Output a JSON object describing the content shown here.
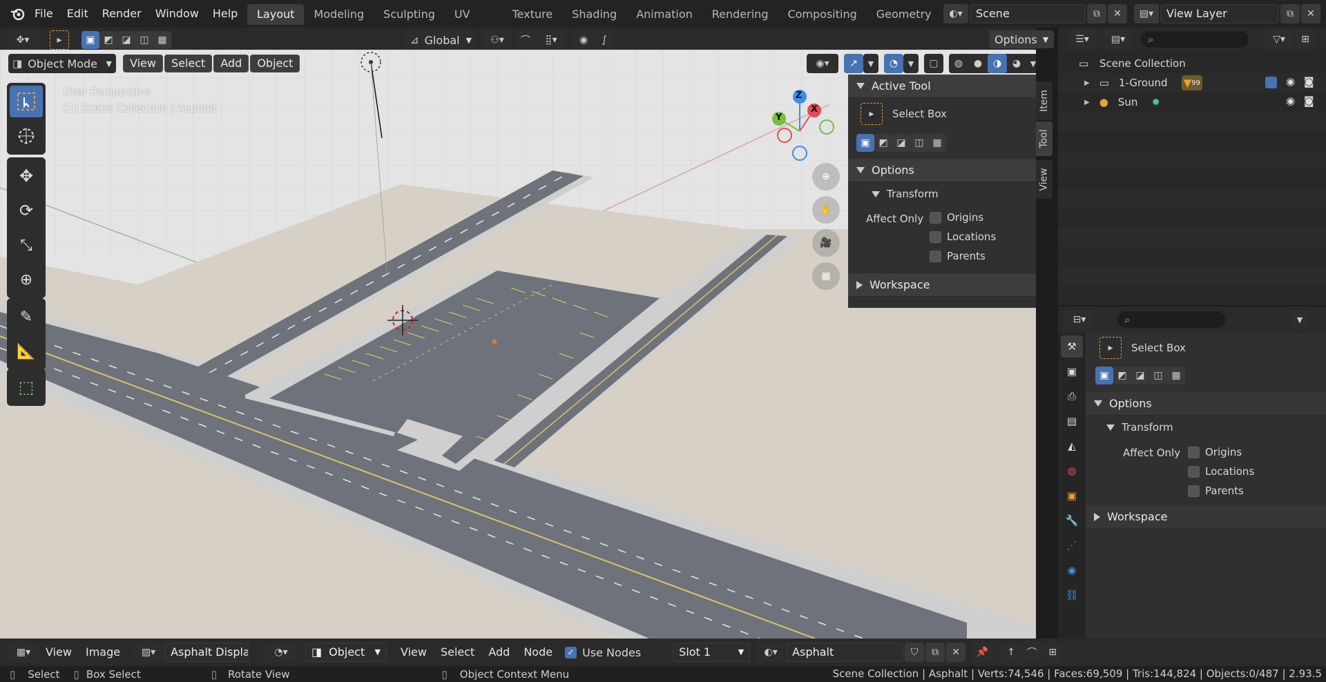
{
  "topbar": {
    "menus": [
      "File",
      "Edit",
      "Render",
      "Window",
      "Help"
    ],
    "workspaces": [
      "Layout",
      "Modeling",
      "Sculpting",
      "UV Editing",
      "Texture Paint",
      "Shading",
      "Animation",
      "Rendering",
      "Compositing",
      "Geometry Nod"
    ],
    "active_workspace": "Layout",
    "scene": "Scene",
    "view_layer": "View Layer"
  },
  "tool_header": {
    "orientation": "Global",
    "options": "Options"
  },
  "viewport_header": {
    "mode": "Object Mode",
    "menus": [
      "View",
      "Select",
      "Add",
      "Object"
    ]
  },
  "viewport": {
    "overlay_line1": "User Perspective",
    "overlay_line2": "(1) Scene Collection | Asphalt",
    "gizmo": {
      "z": "Z",
      "x": "X",
      "y": "Y"
    },
    "colors": {
      "sand": "#d6d0c6",
      "road": "#6e727b",
      "sidewalk": "#cfcfcf",
      "grid_bg": "#e4e4e4",
      "accent": "#4772b3"
    }
  },
  "npanel": {
    "tabs": [
      "Item",
      "Tool",
      "View"
    ],
    "active_tab": "Tool",
    "active_tool_header": "Active Tool",
    "tool_name": "Select Box",
    "options_header": "Options",
    "transform_header": "Transform",
    "affect_only": "Affect Only",
    "checks": [
      "Origins",
      "Locations",
      "Parents"
    ],
    "workspace_header": "Workspace"
  },
  "outliner": {
    "root": "Scene Collection",
    "items": [
      {
        "name": "1-Ground",
        "badge": "99"
      },
      {
        "name": "Sun",
        "badge": ""
      }
    ]
  },
  "properties": {
    "tool_name": "Select Box",
    "options_header": "Options",
    "transform_header": "Transform",
    "affect_only": "Affect Only",
    "checks": [
      "Origins",
      "Locations",
      "Parents"
    ],
    "workspace_header": "Workspace"
  },
  "bottom_bar": {
    "image_menus": [
      "View",
      "Image"
    ],
    "image_name": "Asphalt Displace",
    "object_type": "Object",
    "node_menus": [
      "View",
      "Select",
      "Add",
      "Node"
    ],
    "use_nodes": "Use Nodes",
    "slot": "Slot 1",
    "material": "Asphalt"
  },
  "status_bar": {
    "select": "Select",
    "box_select": "Box Select",
    "rotate_view": "Rotate View",
    "context_menu": "Object Context Menu",
    "stats": "Scene Collection | Asphalt | Verts:74,546 | Faces:69,509 | Tris:144,824 | Objects:0/487 | 2.93.5"
  }
}
